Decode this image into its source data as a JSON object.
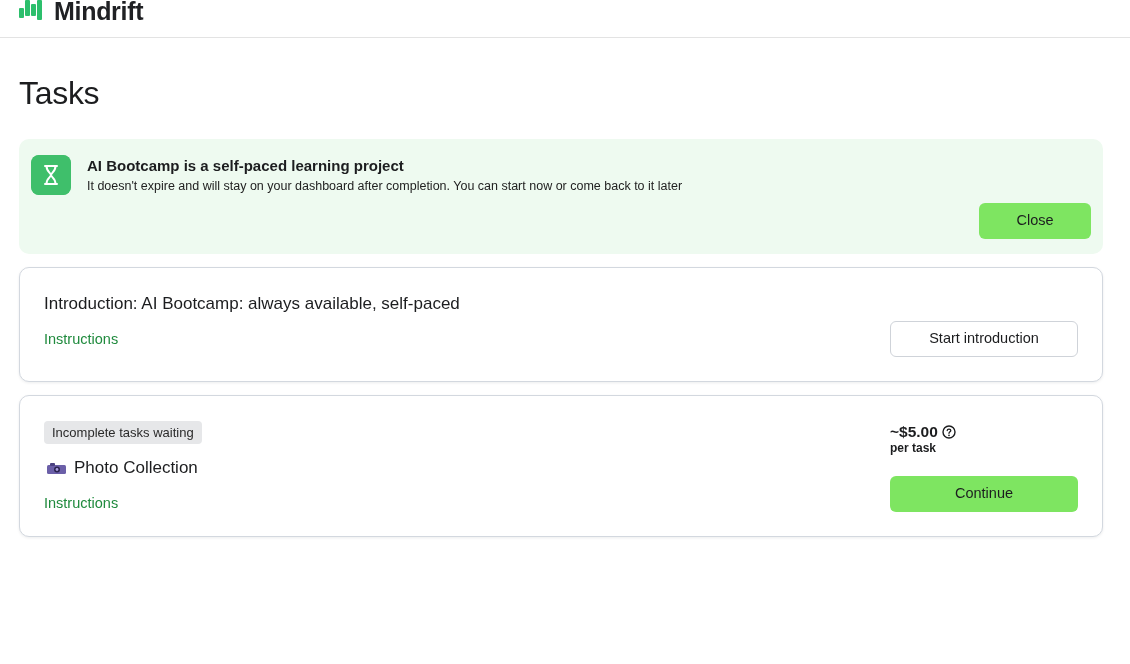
{
  "header": {
    "logo_text": "Mindrift"
  },
  "page_title": "Tasks",
  "banner": {
    "title": "AI Bootcamp is a self-paced learning project",
    "description": "It doesn't expire and will stay on your dashboard after completion. You can start now or come back to it later",
    "close_button": "Close"
  },
  "tasks": [
    {
      "kind": "intro",
      "title": "Introduction: AI Bootcamp: always available, self-paced",
      "link": "Instructions",
      "button": "Start introduction"
    },
    {
      "kind": "project",
      "status_badge": "Incomplete tasks waiting",
      "title": "Photo Collection",
      "link": "Instructions",
      "price": "~$5.00",
      "price_unit": "per task",
      "button": "Continue"
    }
  ]
}
